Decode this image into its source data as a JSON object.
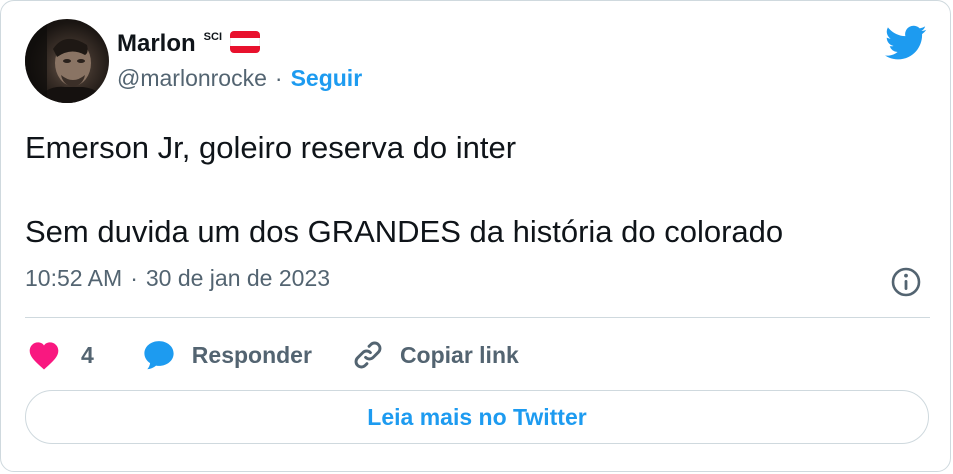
{
  "author": {
    "name": "Marlon",
    "suffix": "SCI",
    "handle": "@marlonrocke",
    "separator": "·",
    "follow_label": "Seguir"
  },
  "icons": {
    "avatar": "profile-photo",
    "flag": "red-white-red-flag-icon",
    "logo": "twitter-bird-icon",
    "info": "info-icon",
    "like": "heart-icon",
    "reply": "speech-bubble-icon",
    "copy": "link-icon"
  },
  "tweet": {
    "line1": "Emerson Jr, goleiro reserva do inter",
    "line2": "Sem duvida um dos GRANDES da história do colorado"
  },
  "meta": {
    "time": "10:52 AM",
    "separator": "·",
    "date": "30 de jan de 2023"
  },
  "actions": {
    "like_count": "4",
    "reply_label": "Responder",
    "copy_label": "Copiar link"
  },
  "read_more_label": "Leia mais no Twitter",
  "colors": {
    "twitter_blue": "#1d9bf0",
    "heart_pink": "#f91880",
    "text_primary": "#0f1419",
    "text_secondary": "#536471",
    "border": "#cfd9de",
    "flag_red": "#e8112d"
  }
}
